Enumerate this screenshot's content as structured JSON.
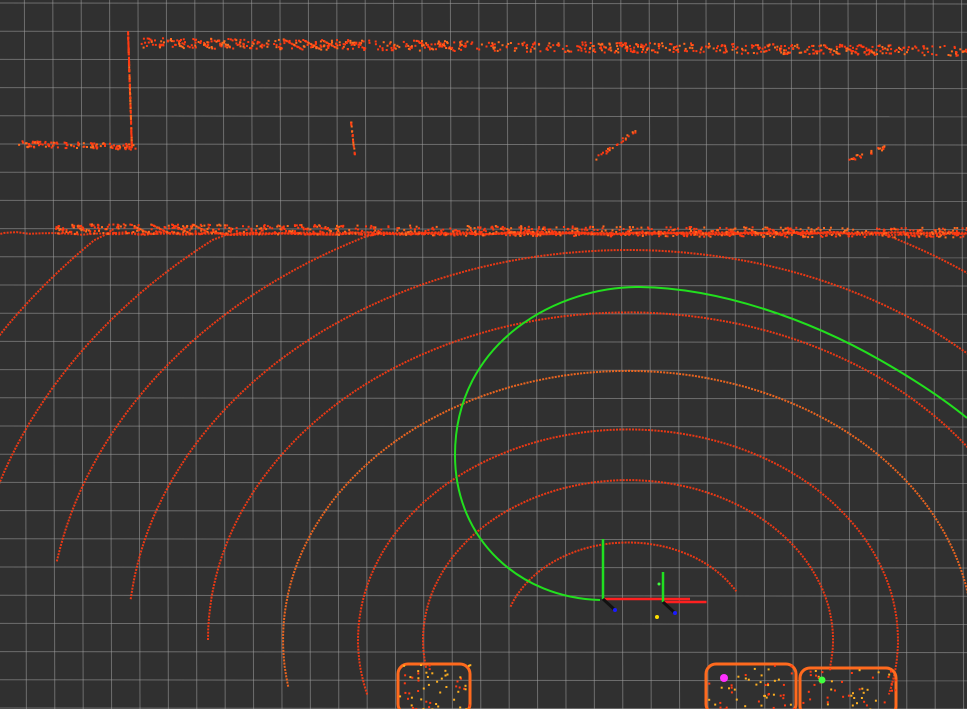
{
  "view": {
    "background_color": "#303030",
    "grid_color": "#a0a0a0",
    "grid_visible": true
  },
  "layers": {
    "pointcloud": {
      "icon": "laser-scan-rings",
      "color": "#ff3a12",
      "accent_color": "#ff6a1e"
    },
    "path": {
      "icon": "planned-path-line",
      "color": "#22e01e"
    },
    "frames": {
      "icon": "tf-axes",
      "x_color": "#ff2020",
      "y_color": "#20e020",
      "z_color": "#1a1aff"
    },
    "markers": {
      "magenta_color": "#ff30ff",
      "green_color": "#40ff40",
      "yellow_color": "#ffe000"
    }
  }
}
